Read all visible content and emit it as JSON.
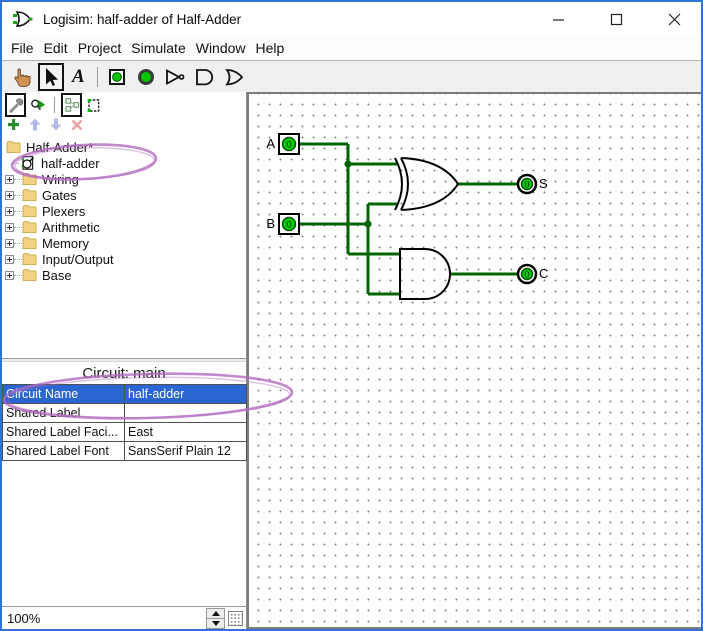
{
  "window": {
    "title": "Logisim: half-adder of Half-Adder",
    "app_icon": "logisim-gate-icon"
  },
  "menu": {
    "items": [
      "File",
      "Edit",
      "Project",
      "Simulate",
      "Window",
      "Help"
    ]
  },
  "toolbar": {
    "text_glyph": "A",
    "tools": [
      {
        "name": "poke-tool",
        "selected": false
      },
      {
        "name": "edit-tool",
        "selected": true
      },
      {
        "name": "text-tool",
        "selected": false
      },
      {
        "name": "input-pin-tool",
        "selected": false
      },
      {
        "name": "output-pin-tool",
        "selected": false
      },
      {
        "name": "not-gate-tool",
        "selected": false
      },
      {
        "name": "and-gate-tool",
        "selected": false
      },
      {
        "name": "or-gate-tool",
        "selected": false
      }
    ]
  },
  "explorer": {
    "view_buttons": [
      "view-toolbox",
      "view-simulation",
      "edit-layout",
      "edit-appearance"
    ],
    "actions": [
      "add-circuit",
      "move-up",
      "move-down",
      "remove-circuit"
    ],
    "root": "Half-Adder*",
    "current_circuit": "half-adder",
    "libraries": [
      "Wiring",
      "Gates",
      "Plexers",
      "Arithmetic",
      "Memory",
      "Input/Output",
      "Base"
    ]
  },
  "attributes": {
    "header": "Circuit: main",
    "rows": [
      {
        "name": "Circuit Name",
        "value": "half-adder",
        "selected": true
      },
      {
        "name": "Shared Label",
        "value": "",
        "selected": false
      },
      {
        "name": "Shared Label Faci...",
        "value": "East",
        "selected": false
      },
      {
        "name": "Shared Label Font",
        "value": "SansSerif Plain 12",
        "selected": false
      }
    ]
  },
  "zoom": {
    "value": "100%"
  },
  "canvas": {
    "labels": {
      "input_a": "A",
      "input_b": "B",
      "output_s": "S",
      "output_c": "C"
    },
    "pin_values": {
      "a": "0",
      "b": "0",
      "s": "0",
      "c": "0"
    },
    "gates": [
      "xor-gate",
      "and-gate"
    ]
  },
  "colors": {
    "window_border": "#2f73d6",
    "selection_blue": "#2a65d2",
    "focus_dotted": "#d2953a",
    "wire_green": "#006400",
    "pin_green": "#00c800",
    "annotation_purple": "#b36cc0",
    "folder_yellow": "#f2d382"
  }
}
